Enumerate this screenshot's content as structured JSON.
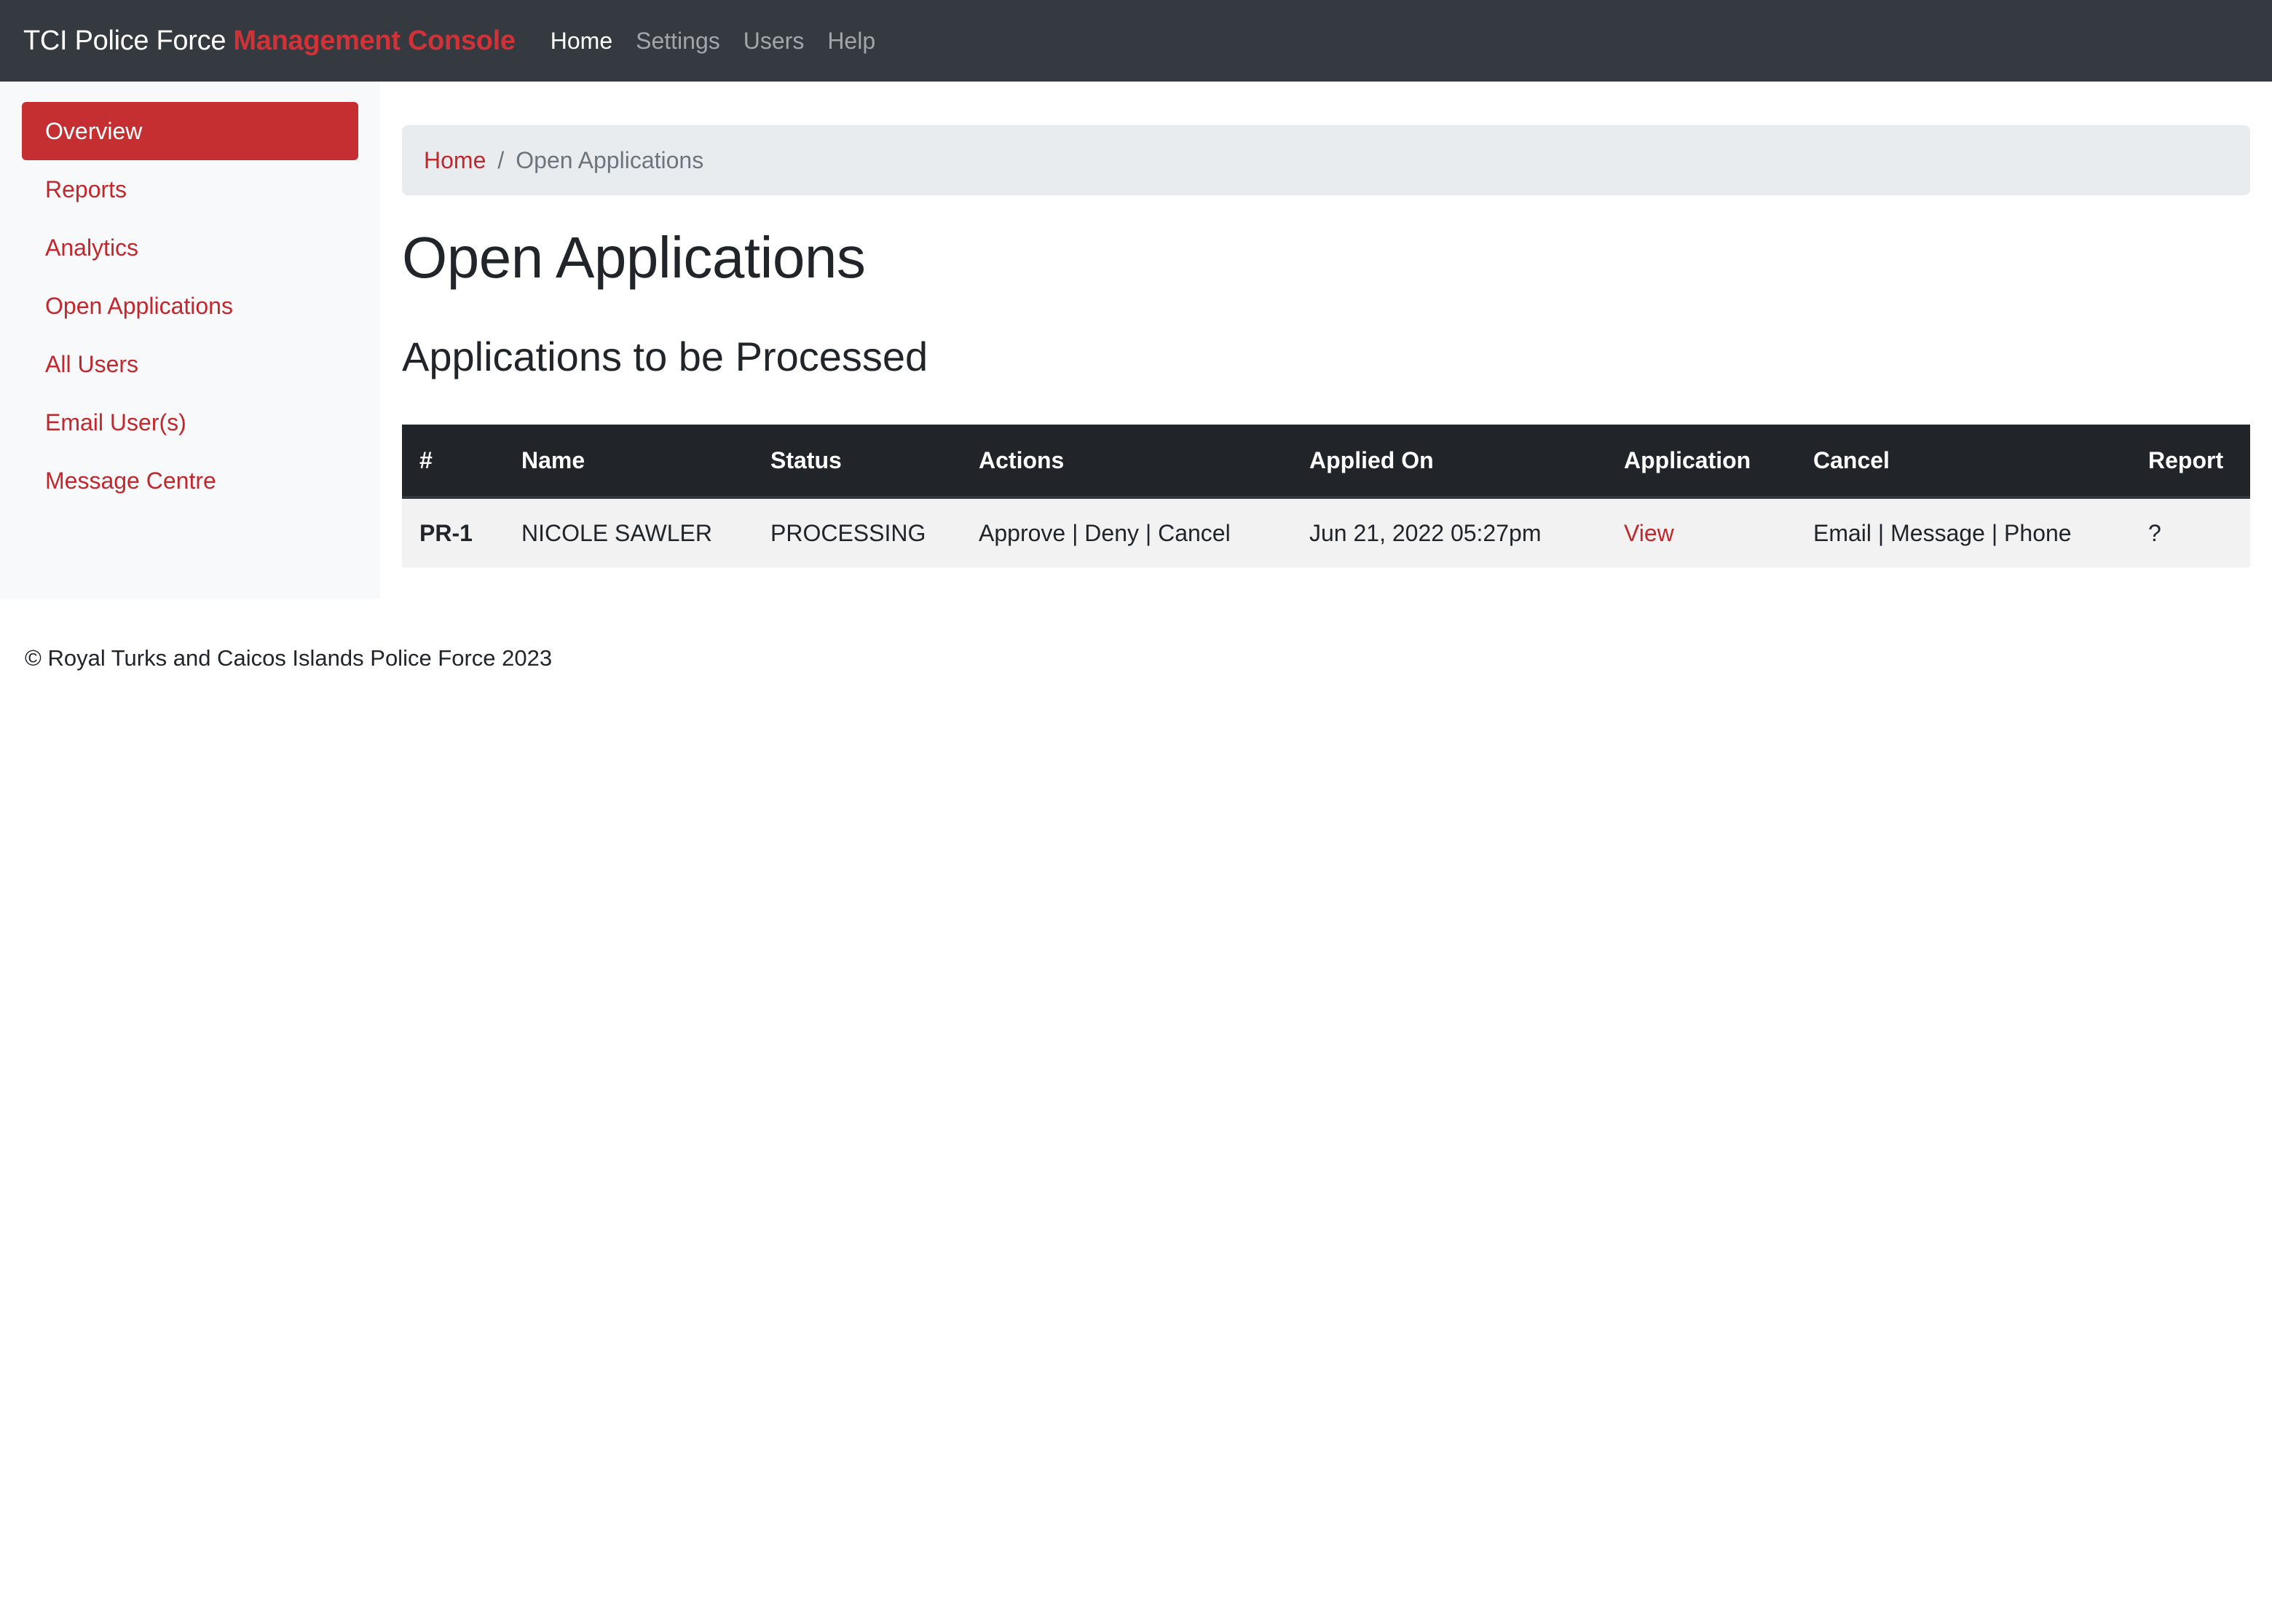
{
  "navbar": {
    "brand_main": "TCI Police Force ",
    "brand_accent": "Management Console",
    "links": [
      "Home",
      "Settings",
      "Users",
      "Help"
    ]
  },
  "sidebar": {
    "items": [
      {
        "label": "Overview"
      },
      {
        "label": "Reports"
      },
      {
        "label": "Analytics"
      },
      {
        "label": "Open Applications"
      },
      {
        "label": "All Users"
      },
      {
        "label": "Email User(s)"
      },
      {
        "label": "Message Centre"
      }
    ]
  },
  "breadcrumb": {
    "home": "Home",
    "separator": "/",
    "current": "Open Applications"
  },
  "main": {
    "title": "Open Applications",
    "section_title": "Applications to be Processed"
  },
  "table": {
    "headers": [
      "#",
      "Name",
      "Status",
      "Actions",
      "Applied On",
      "Application",
      "Cancel",
      "Report"
    ],
    "rows": [
      {
        "id": "PR-1",
        "name": "NICOLE SAWLER",
        "status": "PROCESSING",
        "actions": "Approve | Deny | Cancel",
        "applied_on": "Jun 21, 2022 05:27pm",
        "application": "View",
        "cancel": "Email | Message | Phone",
        "report": "?"
      }
    ]
  },
  "footer": {
    "text": "© Royal Turks and Caicos Islands Police Force 2023"
  },
  "colors": {
    "navbar_bg": "#343a40",
    "accent": "#c62f31",
    "link": "#c1272d"
  }
}
